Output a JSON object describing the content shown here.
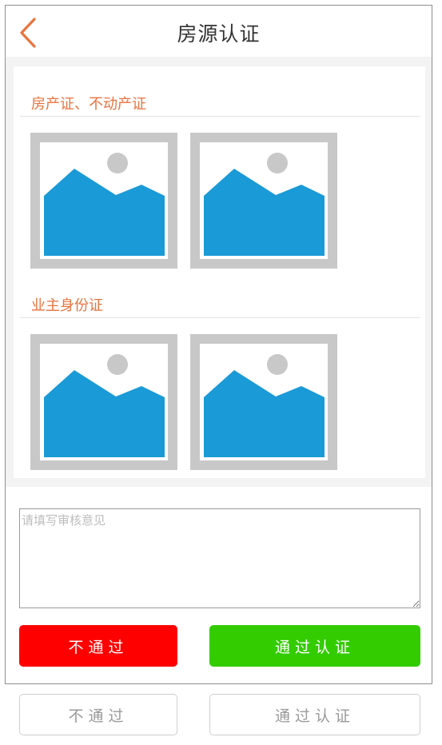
{
  "header": {
    "title": "房源认证",
    "back_icon": "chevron-left-icon",
    "accent_color": "#e8733e"
  },
  "sections": [
    {
      "title": "房产证、不动产证",
      "images": [
        "image-placeholder-icon",
        "image-placeholder-icon"
      ]
    },
    {
      "title": "业主身份证",
      "images": [
        "image-placeholder-icon",
        "image-placeholder-icon"
      ]
    }
  ],
  "review": {
    "placeholder": "请填写审核意见",
    "value": ""
  },
  "actions": {
    "reject_label": "不通过",
    "approve_label": "通过认证",
    "reject_color": "#ff0000",
    "approve_color": "#33cc00"
  },
  "ghost_actions": {
    "reject_label": "不通过",
    "approve_label": "通过认证"
  }
}
